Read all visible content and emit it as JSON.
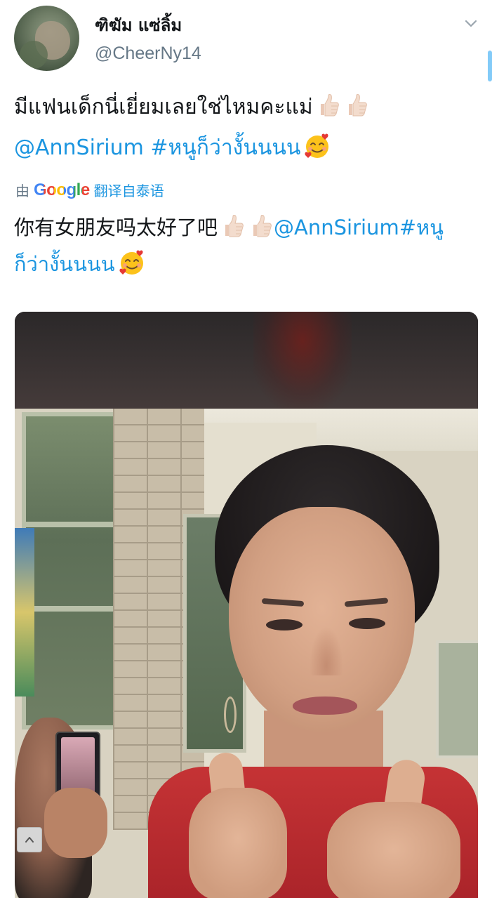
{
  "tweet": {
    "display_name": "ฑิฆัม แซ่ลิ้ม",
    "handle": "@CheerNy14",
    "text_line1": "มีแฟนเด็กนี่เยี่ยมเลยใช่ไหมคะแม่",
    "mention": "@AnnSirium",
    "hashtag": "#หนูก็ว่างั้นนนน",
    "translation": {
      "prefix": "由",
      "provider": "Google",
      "action": "翻译自泰语",
      "text_part1": "你有女朋友吗太好了吧",
      "mention": "@AnnSirium",
      "hashtag_part1": "#หนู",
      "hashtag_part2": "ก็ว่างั้นนนน"
    }
  },
  "icons": {
    "more": "chevron-down-icon",
    "thumbs": "thumbs-up-icon",
    "smile": "smiling-face-with-hearts-icon",
    "collapse": "chevron-up-icon"
  },
  "colors": {
    "link": "#1b95e0",
    "secondary_text": "#657786",
    "primary_text": "#14171a"
  }
}
